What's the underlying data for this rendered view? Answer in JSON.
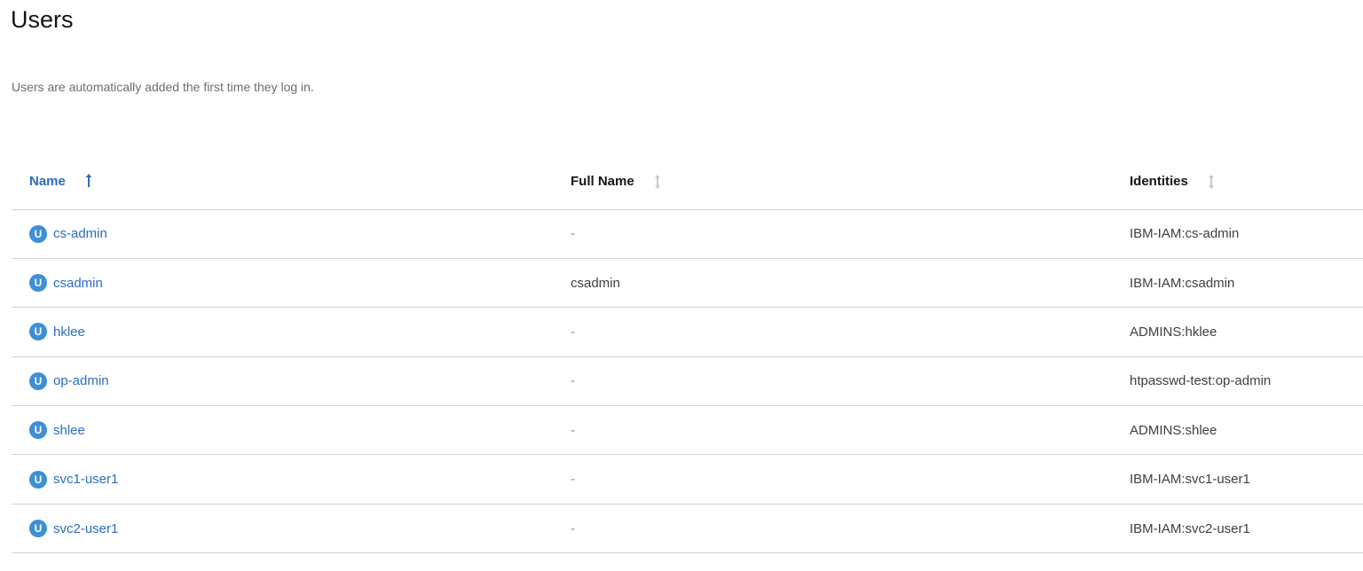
{
  "page": {
    "title": "Users",
    "help_text": "Users are automatically added the first time they log in."
  },
  "table": {
    "columns": [
      {
        "label": "Name",
        "sort": "ascending"
      },
      {
        "label": "Full Name",
        "sort": "none"
      },
      {
        "label": "Identities",
        "sort": "none"
      }
    ],
    "badge_letter": "U",
    "rows": [
      {
        "name": "cs-admin",
        "full_name": "-",
        "identities": "IBM-IAM:cs-admin"
      },
      {
        "name": "csadmin",
        "full_name": "csadmin",
        "identities": "IBM-IAM:csadmin"
      },
      {
        "name": "hklee",
        "full_name": "-",
        "identities": "ADMINS:hklee"
      },
      {
        "name": "op-admin",
        "full_name": "-",
        "identities": "htpasswd-test:op-admin"
      },
      {
        "name": "shlee",
        "full_name": "-",
        "identities": "ADMINS:shlee"
      },
      {
        "name": "svc1-user1",
        "full_name": "-",
        "identities": "IBM-IAM:svc1-user1"
      },
      {
        "name": "svc2-user1",
        "full_name": "-",
        "identities": "IBM-IAM:svc2-user1"
      }
    ]
  },
  "colors": {
    "link": "#2b6cc2",
    "badge": "#3d8fd8",
    "border": "#d2d2d2",
    "muted_text": "#6a6e73"
  },
  "icons": {
    "sort_ascending": "arrow-up-icon",
    "sortable": "sort-icon",
    "user_badge": "user-badge-icon"
  }
}
